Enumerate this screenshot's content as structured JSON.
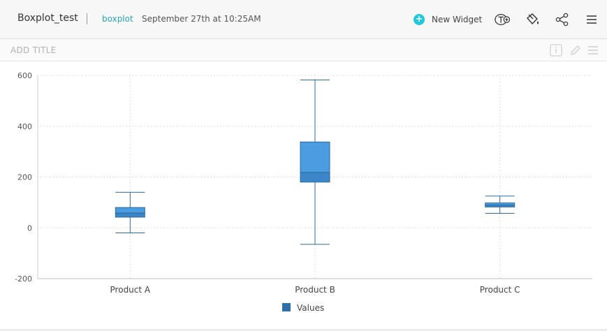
{
  "header": {
    "title": "Boxplot_test",
    "widget_type": "boxplot",
    "timestamp": "September 27th at 10:25AM",
    "new_widget_label": "New Widget",
    "icons": [
      "text-add-icon",
      "paint-bucket-icon",
      "share-icon",
      "menu-icon"
    ]
  },
  "widget": {
    "title_placeholder": "ADD TITLE",
    "icons": [
      "info-icon",
      "pencil-icon",
      "hamburger-icon"
    ]
  },
  "colors": {
    "accent": "#1fc8db",
    "box_upper": "#4b9de2",
    "box_lower": "#3a86c8",
    "box_stroke": "#2f6b9e",
    "legend": "#2f6fa8"
  },
  "chart_data": {
    "type": "boxplot",
    "categories": [
      "Product A",
      "Product B",
      "Product C"
    ],
    "series": [
      {
        "name": "Values",
        "boxes": [
          {
            "min": -20,
            "q1": 42,
            "median": 58,
            "q3": 80,
            "max": 140
          },
          {
            "min": -65,
            "q1": 180,
            "median": 218,
            "q3": 338,
            "max": 582
          },
          {
            "min": 57,
            "q1": 82,
            "median": 90,
            "q3": 98,
            "max": 125
          }
        ]
      }
    ],
    "ylim": [
      -200,
      600
    ],
    "yticks": [
      -200,
      0,
      200,
      400,
      600
    ],
    "grid": true,
    "legend_position": "bottom"
  }
}
